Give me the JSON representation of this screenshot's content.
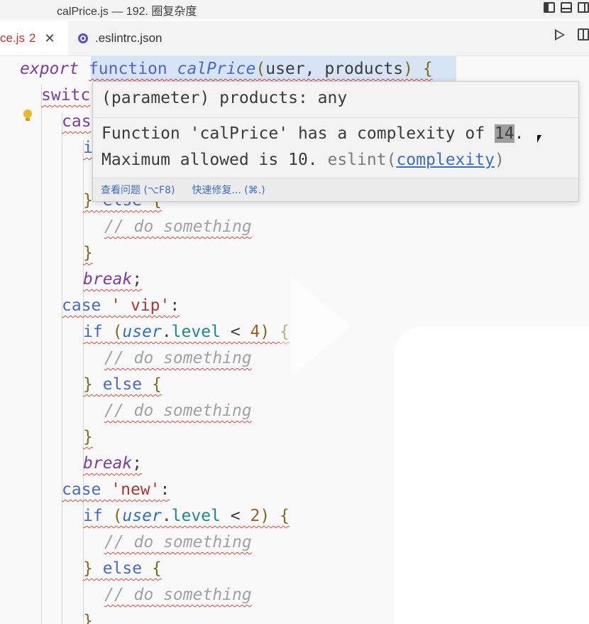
{
  "window": {
    "title": "calPrice.js — 192. 圈复杂度"
  },
  "tabs": [
    {
      "label": "ce.js",
      "problems": "2",
      "close": "✕"
    },
    {
      "label": ".eslintrc.json"
    }
  ],
  "code": {
    "l1": {
      "export": "export",
      "function": "function",
      "name": "calPrice",
      "open": "(",
      "p1": "user",
      "comma": ", ",
      "p2": "products",
      "close": ")",
      "brace": "{"
    },
    "l2": {
      "text": "switc"
    },
    "l3": {
      "text": "cas"
    },
    "l4": {
      "text": "i"
    },
    "l6": {
      "close": "}",
      "else": "else",
      "open": "{"
    },
    "l7": {
      "comment": "// do something"
    },
    "l8": {
      "close": "}"
    },
    "l9": {
      "break": "break",
      "semi": ";"
    },
    "l10": {
      "case": "case",
      "str": "' vip'",
      "colon": ":"
    },
    "l11": {
      "if": "if",
      "open": "(",
      "obj": "user",
      "dot": ".",
      "prop": "level",
      "op": " < ",
      "num": "4",
      "close": ")",
      "brace": "{"
    },
    "l12": {
      "comment": "// do something"
    },
    "l13": {
      "close": "}",
      "else": "else",
      "open": "{"
    },
    "l14": {
      "comment": "// do something"
    },
    "l15": {
      "close": "}"
    },
    "l16": {
      "break": "break",
      "semi": ";"
    },
    "l17": {
      "case": "case",
      "str": "'new'",
      "colon": ":"
    },
    "l18": {
      "if": "if",
      "open": "(",
      "obj": "user",
      "dot": ".",
      "prop": "level",
      "op": " < ",
      "num": "2",
      "close": ")",
      "brace": "{"
    },
    "l19": {
      "comment": "// do something"
    },
    "l20": {
      "close": "}",
      "else": "else",
      "open": "{"
    },
    "l21": {
      "comment": "// do something"
    },
    "l22": {
      "close": "}"
    }
  },
  "hover": {
    "signature": "(parameter) products: any",
    "message_line1_before": "Function 'calPrice' has a complexity of ",
    "message_line1_num": "14",
    "message_line1_after": ".",
    "message_line2_before": "Maximum allowed is 10. ",
    "source": "eslint",
    "paren_open": "(",
    "rule": "complexity",
    "paren_close": ")",
    "action_view_problem": "查看问题 (⌥F8)",
    "action_quick_fix": "快速修复... (⌘.)"
  },
  "colors": {
    "error_squiggle": "#e0443a",
    "link": "#3c6fc2",
    "keyword": "#7a3e9d"
  }
}
